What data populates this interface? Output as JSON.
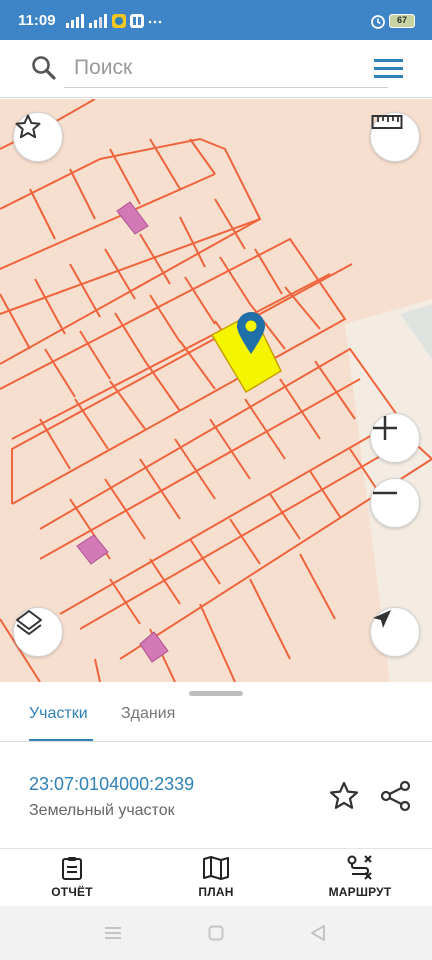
{
  "status_bar": {
    "time": "11:09",
    "battery": "67"
  },
  "search": {
    "placeholder": "Поиск"
  },
  "tabs": [
    {
      "label": "Участки",
      "active": true
    },
    {
      "label": "Здания",
      "active": false
    }
  ],
  "parcel": {
    "number": "23:07:0104000:2339",
    "type": "Земельный участок"
  },
  "bottom_nav": [
    {
      "label": "ОТЧЁТ",
      "icon": "clipboard-icon"
    },
    {
      "label": "ПЛАН",
      "icon": "map-icon"
    },
    {
      "label": "МАРШРУТ",
      "icon": "route-icon"
    }
  ],
  "colors": {
    "status_bar": "#3d85c6",
    "accent": "#2f81b7",
    "map_background": "#f7dfd0",
    "parcel_lines": "#f0643c",
    "selected_parcel": "#f5f500",
    "building": "#d37ab6"
  }
}
